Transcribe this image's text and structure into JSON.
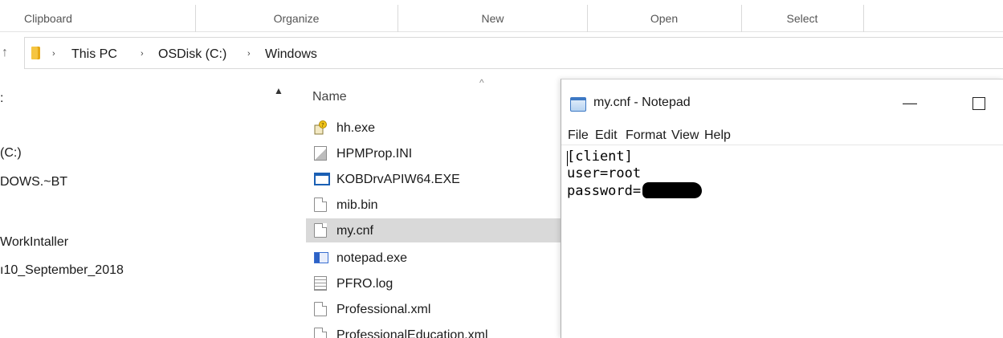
{
  "ribbon": {
    "groups": [
      "Clipboard",
      "Organize",
      "New",
      "Open",
      "Select"
    ]
  },
  "address_bar": {
    "nav_up_glyph": "↑",
    "separator": "›",
    "breadcrumbs": [
      "This PC",
      "OSDisk (C:)",
      "Windows"
    ]
  },
  "nav_pane": {
    "items": [
      {
        "label": ":"
      },
      {
        "label": "(C:)"
      },
      {
        "label": "DOWS.~BT"
      },
      {
        "label": "WorkIntaller"
      },
      {
        "label": "ı10_September_2018"
      }
    ]
  },
  "file_list": {
    "column_name": "Name",
    "sort_glyph": "^",
    "files": [
      {
        "name": "hh.exe",
        "icon": "help-exe-icon"
      },
      {
        "name": "HPMProp.INI",
        "icon": "ini-settings-icon"
      },
      {
        "name": "KOBDrvAPIW64.EXE",
        "icon": "application-window-icon"
      },
      {
        "name": "mib.bin",
        "icon": "blank-file-icon"
      },
      {
        "name": "my.cnf",
        "icon": "blank-file-icon",
        "selected": true
      },
      {
        "name": "notepad.exe",
        "icon": "notepad-app-icon"
      },
      {
        "name": "PFRO.log",
        "icon": "text-log-icon"
      },
      {
        "name": "Professional.xml",
        "icon": "blank-file-icon"
      },
      {
        "name": "ProfessionalEducation.xml",
        "icon": "blank-file-icon"
      }
    ]
  },
  "notepad": {
    "title": "my.cnf - Notepad",
    "minimize_glyph": "—",
    "menu": [
      "File",
      "Edit",
      "Format",
      "View",
      "Help"
    ],
    "lines": [
      "[client]",
      "user=root",
      "password="
    ]
  }
}
